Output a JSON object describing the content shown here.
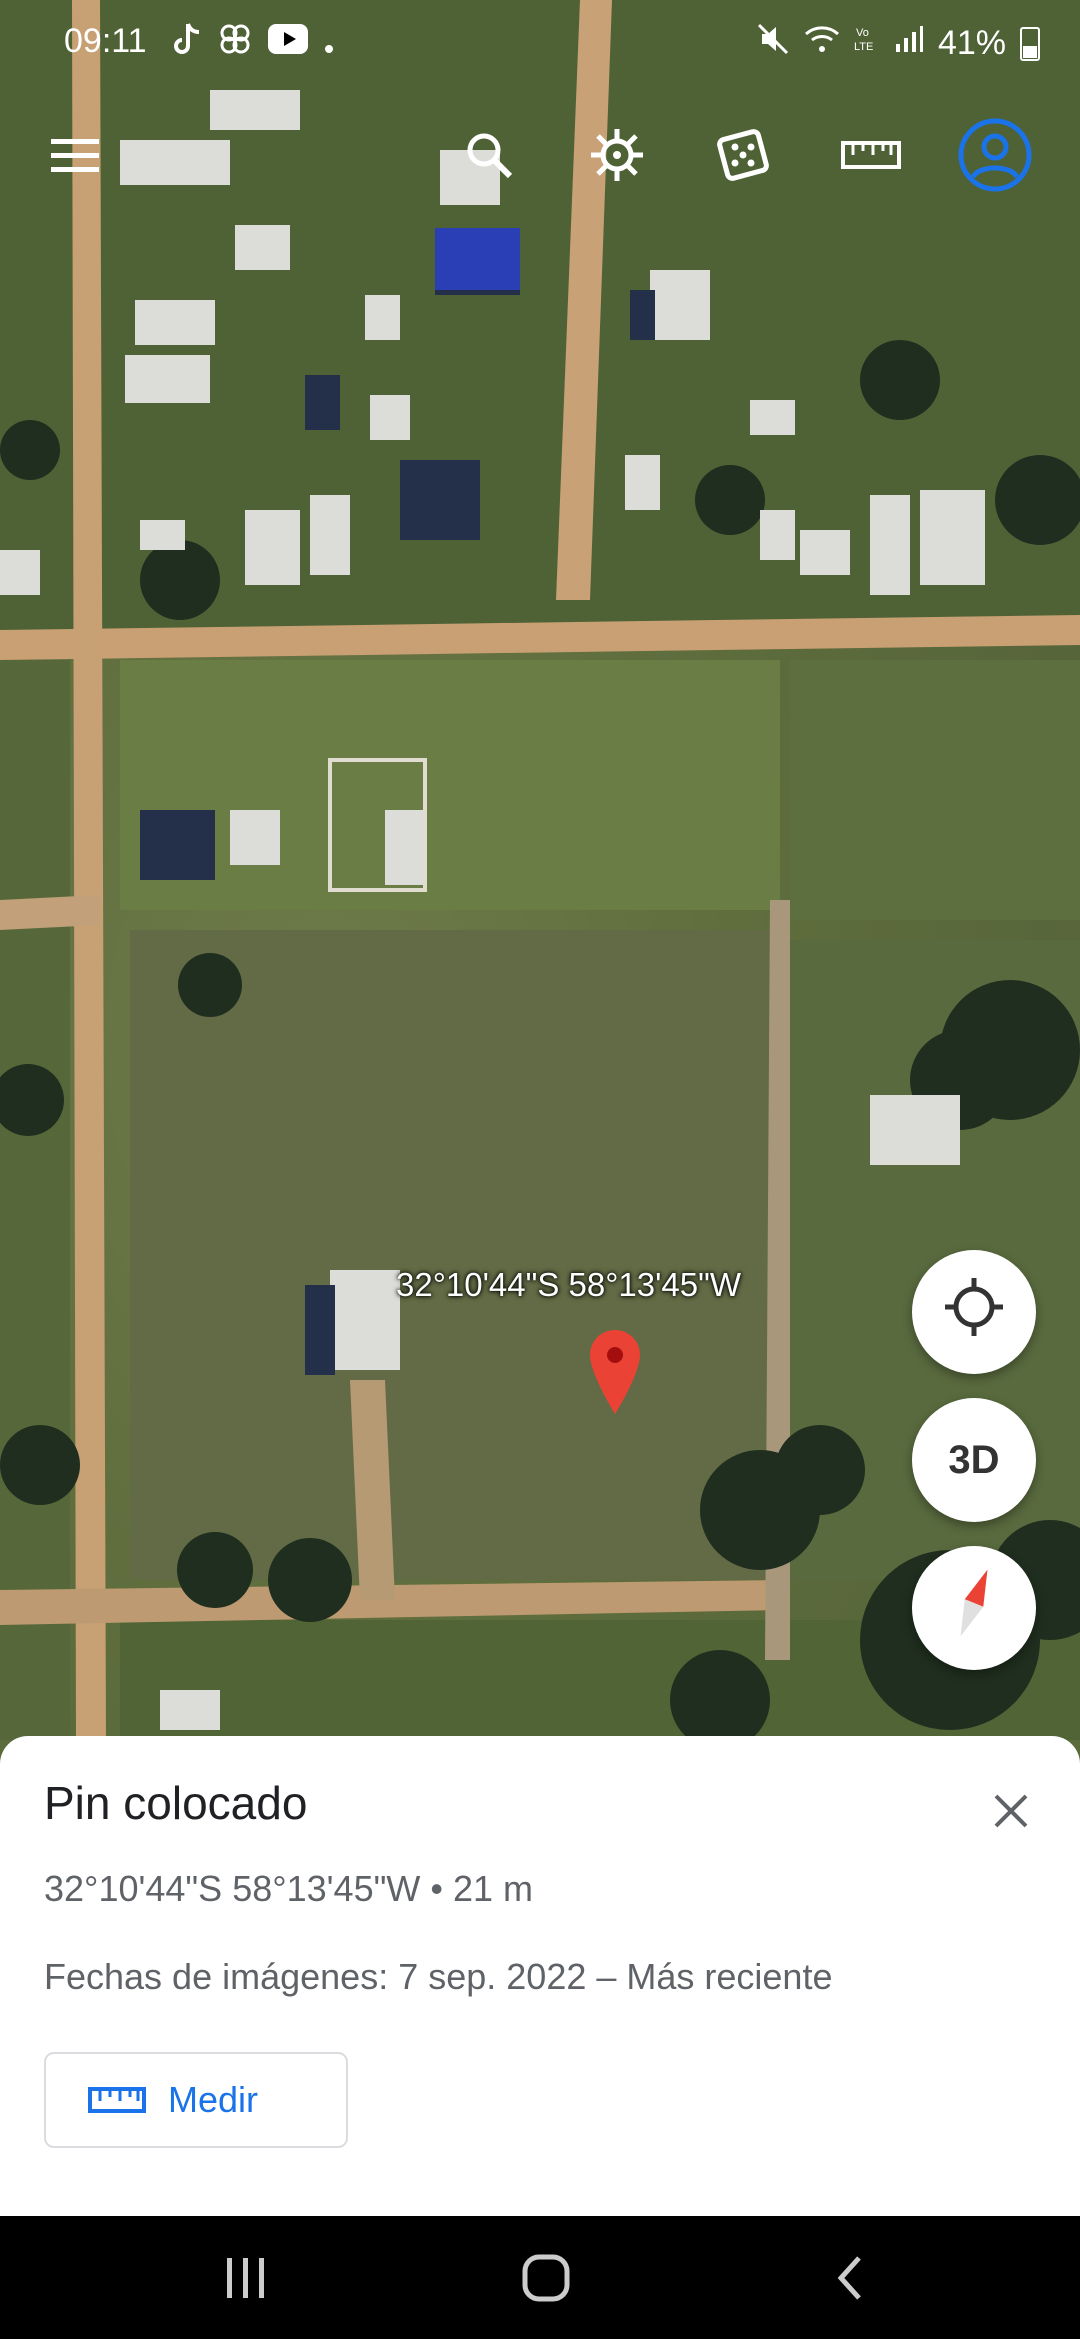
{
  "status_bar": {
    "time": "09:11",
    "battery": "41%",
    "icons": [
      "tiktok-icon",
      "pinwheel-icon",
      "youtube-icon",
      "dot-icon",
      "mute-icon",
      "wifi-icon",
      "volte-icon",
      "signal-icon",
      "battery-icon"
    ]
  },
  "toolbar": {
    "icons": [
      "menu-icon",
      "search-icon",
      "voyager-icon",
      "dice-icon",
      "ruler-icon",
      "account-icon"
    ]
  },
  "map": {
    "pin_label": "32°10'44\"S 58°13'45\"W",
    "pin_color": "#ea4335"
  },
  "fabs": {
    "locate_icon": "locate-icon",
    "three_d_label": "3D",
    "compass_icon": "compass-icon"
  },
  "sheet": {
    "title": "Pin colocado",
    "coords": "32°10'44\"S 58°13'45\"W • 21 m",
    "dates": "Fechas de imágenes: 7 sep. 2022 – Más reciente",
    "measure_label": "Medir",
    "accent": "#1a73e8"
  },
  "navbar": {
    "icons": [
      "recents-icon",
      "home-icon",
      "back-icon"
    ]
  }
}
